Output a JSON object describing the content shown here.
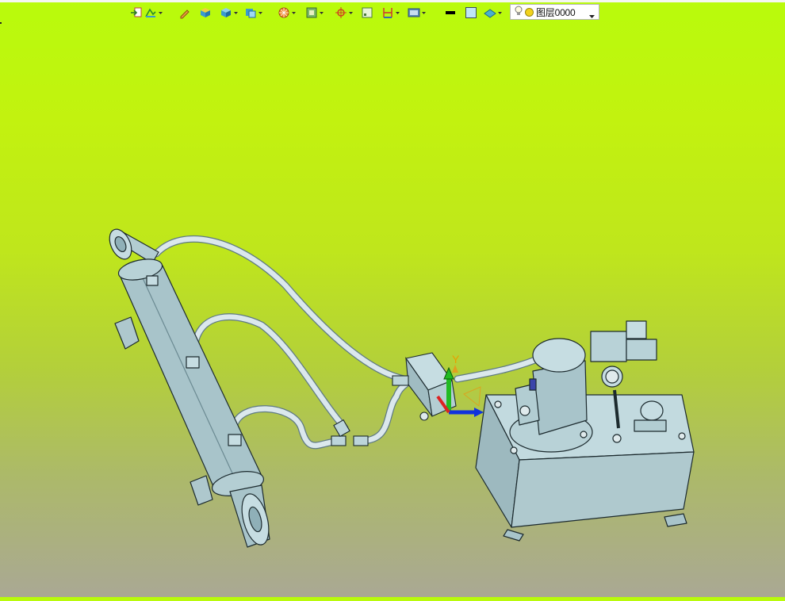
{
  "toolbar": {
    "icons": [
      "exit-icon",
      "sketch-icon",
      "pencil-icon",
      "box-solid-icon",
      "cube-icon",
      "shaded-cube-icon",
      "render-mode-icon",
      "frame-icon",
      "snap-icon",
      "rect-select-icon",
      "dimension-icon",
      "view-icon",
      "line-color-swatch",
      "face-color-swatch",
      "surface-icon"
    ],
    "layer": {
      "name": "图层0000"
    }
  },
  "viewport": {
    "background_top": "#b9fb0c",
    "background_bottom": "#aaa894",
    "triad": {
      "y_label": "Y",
      "x_color": "#1133dd",
      "y_color": "#22bb22",
      "z_color": "#dd2222"
    },
    "part_color": "#a8c4ca"
  }
}
